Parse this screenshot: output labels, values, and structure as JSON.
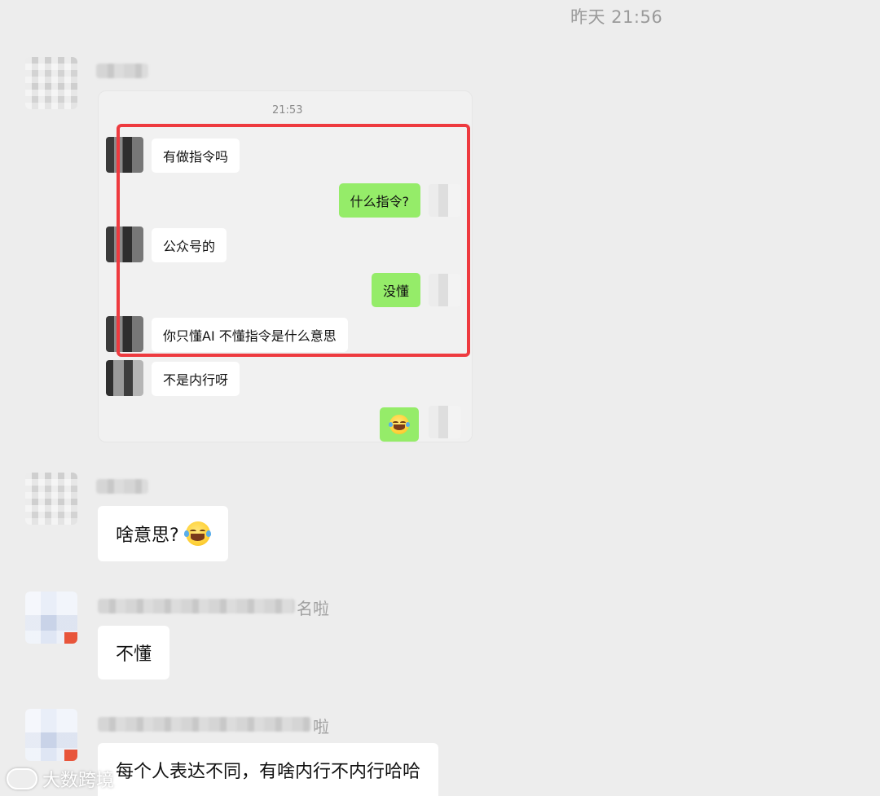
{
  "header": {
    "timestamp": "昨天 21:56"
  },
  "forwarded_card": {
    "time": "21:53",
    "messages": [
      {
        "side": "left",
        "text": "有做指令吗"
      },
      {
        "side": "right",
        "text": "什么指令?"
      },
      {
        "side": "left",
        "text": "公众号的"
      },
      {
        "side": "right",
        "text": "没懂"
      },
      {
        "side": "left",
        "text": "你只懂AI  不懂指令是什么意思"
      },
      {
        "side": "left",
        "text": "不是内行呀"
      },
      {
        "side": "right",
        "emoji": "tears-of-joy-emoji"
      }
    ],
    "highlight_color": "#ee3a3f"
  },
  "messages": [
    {
      "text": "啥意思?",
      "emoji": "tears-of-joy-emoji"
    },
    {
      "name_suffix": "名啦",
      "text": "不懂"
    },
    {
      "name_suffix": "啦",
      "text": "每个人表达不同，有啥内行不内行哈哈"
    }
  ],
  "watermark": {
    "text": "大数跨境"
  },
  "colors": {
    "background": "#ededed",
    "bubble_white": "#ffffff",
    "bubble_green": "#95ec69",
    "timestamp": "#9a9a9a"
  }
}
